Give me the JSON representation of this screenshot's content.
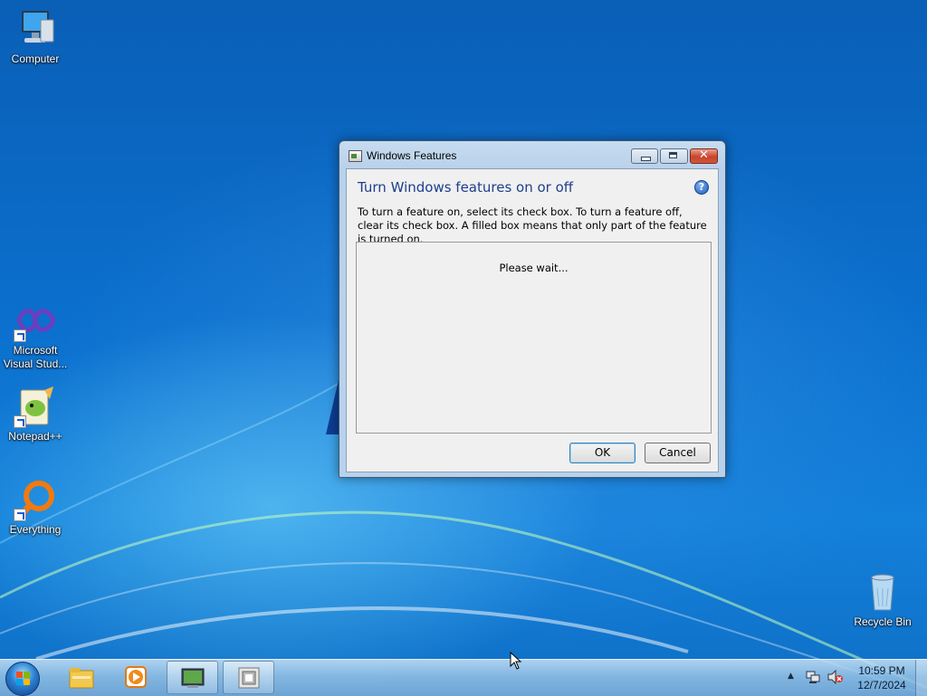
{
  "desktop": {
    "icons": [
      {
        "label": "Computer",
        "icon": "computer-icon"
      },
      {
        "label": "Microsoft Visual Stud...",
        "icon": "visual-studio-icon"
      },
      {
        "label": "Notepad++",
        "icon": "notepad-plus-plus-icon"
      },
      {
        "label": "Everything",
        "icon": "everything-search-icon"
      },
      {
        "label": "Recycle Bin",
        "icon": "recycle-bin-icon"
      }
    ]
  },
  "dialog": {
    "title": "Windows Features",
    "heading": "Turn Windows features on or off",
    "description": "To turn a feature on, select its check box. To turn a feature off, clear its check box. A filled box means that only part of the feature is turned on.",
    "list_status": "Please wait...",
    "ok_label": "OK",
    "cancel_label": "Cancel",
    "help_glyph": "?",
    "close_glyph": "✕"
  },
  "taskbar": {
    "pinned": [
      {
        "icon": "windows-explorer-icon",
        "active": false
      },
      {
        "icon": "media-player-icon",
        "active": false
      },
      {
        "icon": "control-panel-icon",
        "active": true
      },
      {
        "icon": "windows-features-icon",
        "active": true
      }
    ],
    "tray_arrow": "▲",
    "clock_time": "10:59 PM",
    "clock_date": "12/7/2024"
  },
  "colors": {
    "heading": "#1e3f8c",
    "desktop": "#0b6fcd",
    "close_button": "#c8432a"
  }
}
